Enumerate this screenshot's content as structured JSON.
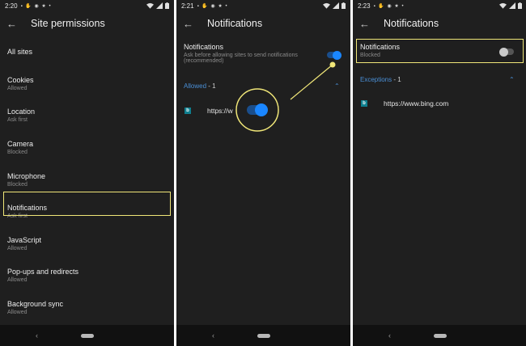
{
  "panel1": {
    "time": "2:20",
    "title": "Site permissions",
    "items": [
      {
        "title": "All sites",
        "sub": ""
      },
      {
        "title": "Cookies",
        "sub": "Allowed"
      },
      {
        "title": "Location",
        "sub": "Ask first"
      },
      {
        "title": "Camera",
        "sub": "Blocked"
      },
      {
        "title": "Microphone",
        "sub": "Blocked"
      },
      {
        "title": "Notifications",
        "sub": "Ask first"
      },
      {
        "title": "JavaScript",
        "sub": "Allowed"
      },
      {
        "title": "Pop-ups and redirects",
        "sub": "Allowed"
      },
      {
        "title": "Background sync",
        "sub": "Allowed"
      }
    ]
  },
  "panel2": {
    "time": "2:21",
    "title": "Notifications",
    "setting_title": "Notifications",
    "setting_desc_1": "Ask before allowing sites to send notifications",
    "setting_desc_2": "(recommended)",
    "toggle_on": true,
    "section_label": "Allowed",
    "section_count": " - 1",
    "site_url": "https://w"
  },
  "panel3": {
    "time": "2:23",
    "title": "Notifications",
    "setting_title": "Notifications",
    "setting_sub": "Blocked",
    "toggle_on": false,
    "section_label": "Exceptions",
    "section_count": " - 1",
    "site_url": "https://www.bing.com"
  },
  "common": {
    "back_glyph": "←",
    "nav_back_glyph": "‹",
    "chevron_up_glyph": "⌃",
    "status_glyphs": "▪ ✋ ◉ ★ •",
    "favicon_letter": "b"
  },
  "colors": {
    "highlight": "#f0e678",
    "accent": "#1a86ff",
    "section": "#4a8fd6",
    "background": "#1f1f1f"
  }
}
